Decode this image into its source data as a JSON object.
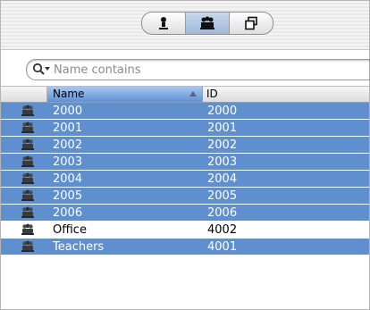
{
  "toolbar": {
    "buttons": [
      {
        "icon": "user-icon",
        "selected": false
      },
      {
        "icon": "group-icon",
        "selected": true
      },
      {
        "icon": "computer-list-icon",
        "selected": false
      }
    ]
  },
  "search": {
    "placeholder": "Name contains",
    "value": ""
  },
  "table": {
    "columns": [
      "Name",
      "ID"
    ],
    "sorted_by": "Name",
    "sort_direction": "ascending",
    "rows": [
      {
        "name": "2000",
        "id": "2000",
        "selected": true
      },
      {
        "name": "2001",
        "id": "2001",
        "selected": true
      },
      {
        "name": "2002",
        "id": "2002",
        "selected": true
      },
      {
        "name": "2003",
        "id": "2003",
        "selected": true
      },
      {
        "name": "2004",
        "id": "2004",
        "selected": true
      },
      {
        "name": "2005",
        "id": "2005",
        "selected": true
      },
      {
        "name": "2006",
        "id": "2006",
        "selected": true
      },
      {
        "name": "Office",
        "id": "4002",
        "selected": false
      },
      {
        "name": "Teachers",
        "id": "4001",
        "selected": true
      }
    ]
  },
  "colors": {
    "selection": "#5f8fcf",
    "header_sorted": "#7ea5de"
  }
}
